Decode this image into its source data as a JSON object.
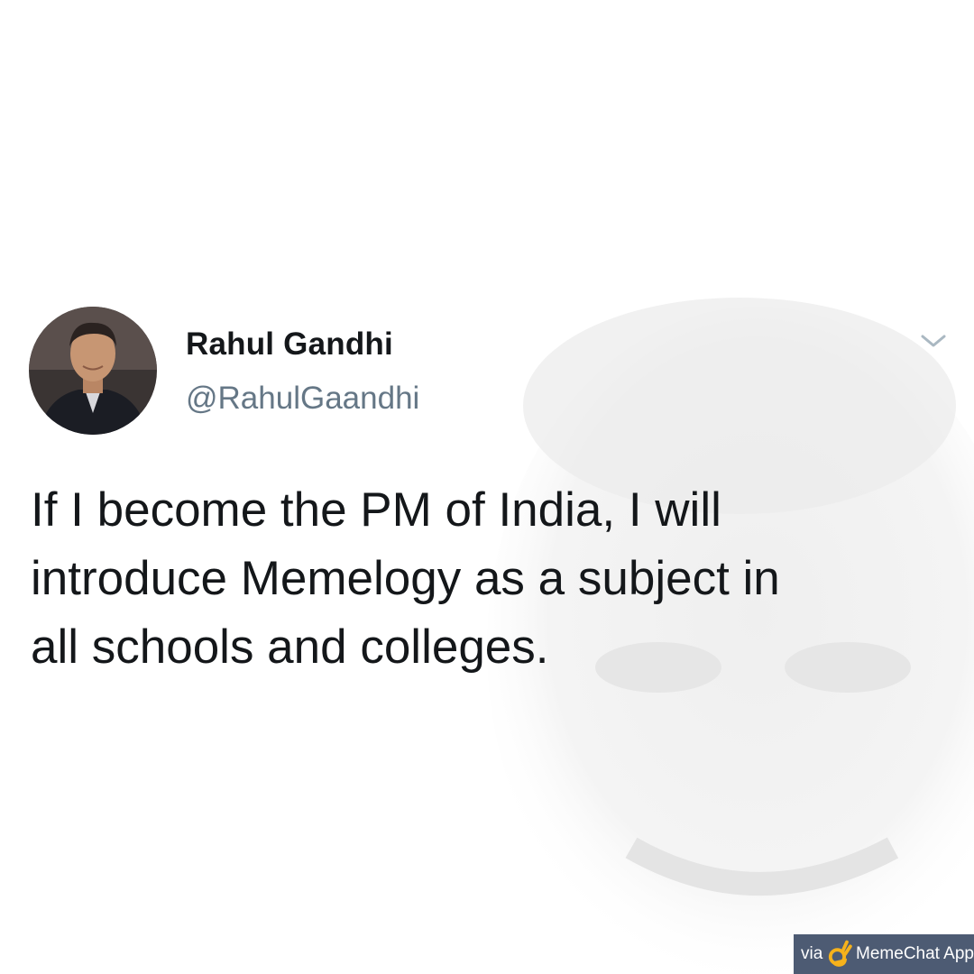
{
  "tweet": {
    "display_name": "Rahul Gandhi",
    "handle": "@RahulGaandhi",
    "lines": [
      "If I become the PM of India, I will",
      "introduce Memelogy as a subject in",
      "all schools and colleges."
    ],
    "menu_icon": "chevron-down-icon",
    "avatar_icon": "profile-photo"
  },
  "watermark": {
    "via": "via",
    "icon": "ok-hand-icon",
    "app_name": "MemeChat App"
  },
  "colors": {
    "name": "#14171a",
    "handle": "#657786",
    "chevron": "#aab8c2",
    "watermark_bg": "#4d5b73"
  }
}
